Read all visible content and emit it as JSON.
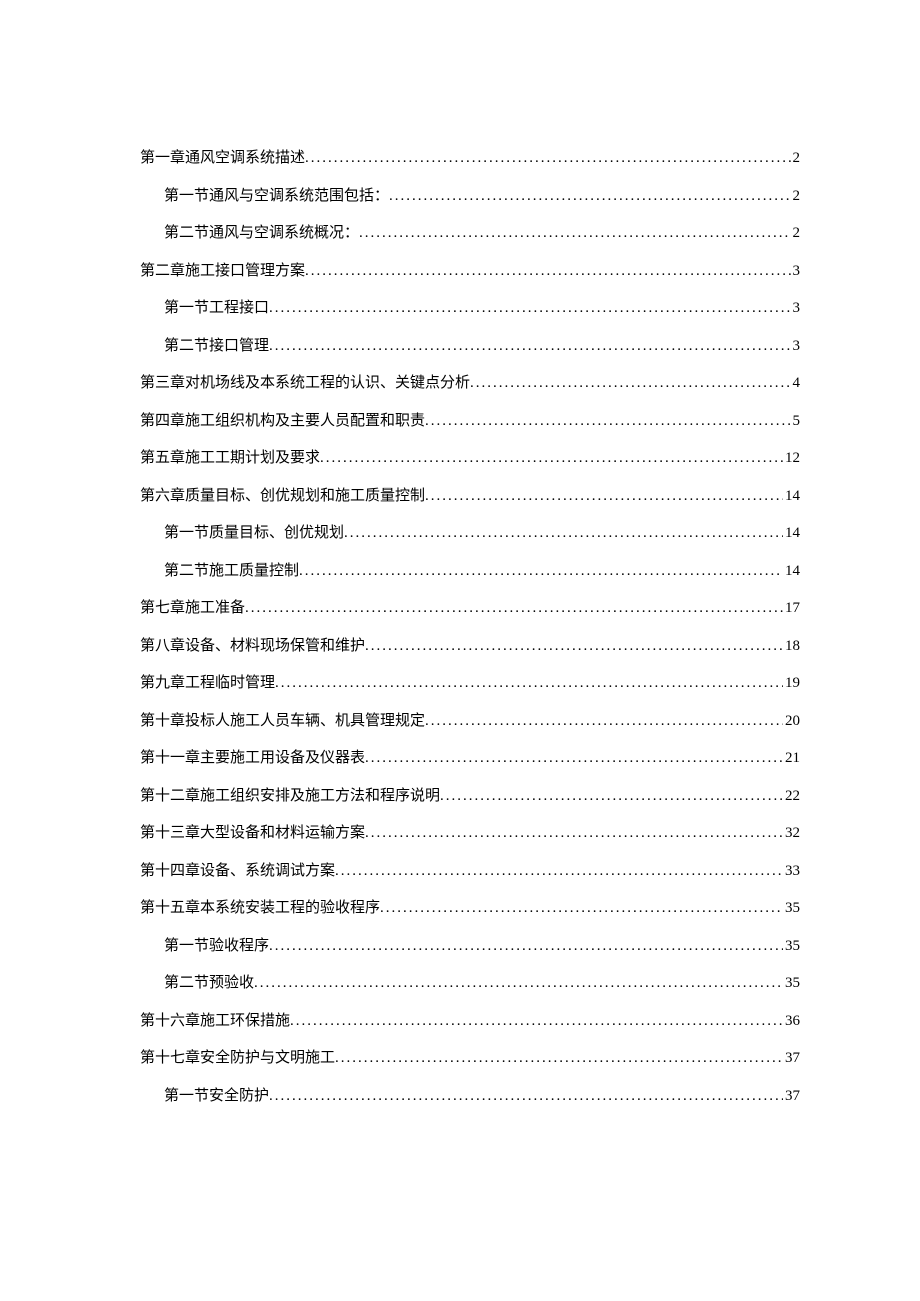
{
  "toc": [
    {
      "level": 1,
      "title": "第一章通风空调系统描述",
      "page": "2"
    },
    {
      "level": 2,
      "title": "第一节通风与空调系统范围包括：",
      "page": "2"
    },
    {
      "level": 2,
      "title": "第二节通风与空调系统概况：",
      "page": "2"
    },
    {
      "level": 1,
      "title": "第二章施工接口管理方案",
      "page": "3"
    },
    {
      "level": 2,
      "title": "第一节工程接口",
      "page": "3"
    },
    {
      "level": 2,
      "title": "第二节接口管理",
      "page": "3"
    },
    {
      "level": 1,
      "title": "第三章对机场线及本系统工程的认识、关键点分析",
      "page": "4"
    },
    {
      "level": 1,
      "title": "第四章施工组织机构及主要人员配置和职责",
      "page": "5"
    },
    {
      "level": 1,
      "title": "第五章施工工期计划及要求",
      "page": "12"
    },
    {
      "level": 1,
      "title": "第六章质量目标、创优规划和施工质量控制",
      "page": "14"
    },
    {
      "level": 2,
      "title": "第一节质量目标、创优规划",
      "page": "14"
    },
    {
      "level": 2,
      "title": "第二节施工质量控制",
      "page": "14"
    },
    {
      "level": 1,
      "title": "第七章施工准备",
      "page": "17"
    },
    {
      "level": 1,
      "title": "第八章设备、材料现场保管和维护",
      "page": "18"
    },
    {
      "level": 1,
      "title": "第九章工程临时管理",
      "page": "19"
    },
    {
      "level": 1,
      "title": "第十章投标人施工人员车辆、机具管理规定",
      "page": "20"
    },
    {
      "level": 1,
      "title": "第十一章主要施工用设备及仪器表",
      "page": "21"
    },
    {
      "level": 1,
      "title": "第十二章施工组织安排及施工方法和程序说明",
      "page": "22"
    },
    {
      "level": 1,
      "title": "第十三章大型设备和材料运输方案",
      "page": "32"
    },
    {
      "level": 1,
      "title": "第十四章设备、系统调试方案",
      "page": "33"
    },
    {
      "level": 1,
      "title": "第十五章本系统安装工程的验收程序",
      "page": "35"
    },
    {
      "level": 2,
      "title": "第一节验收程序",
      "page": "35"
    },
    {
      "level": 2,
      "title": "第二节预验收",
      "page": "35"
    },
    {
      "level": 1,
      "title": "第十六章施工环保措施",
      "page": "36"
    },
    {
      "level": 1,
      "title": "第十七章安全防护与文明施工",
      "page": "37"
    },
    {
      "level": 2,
      "title": "第一节安全防护",
      "page": "37"
    }
  ]
}
